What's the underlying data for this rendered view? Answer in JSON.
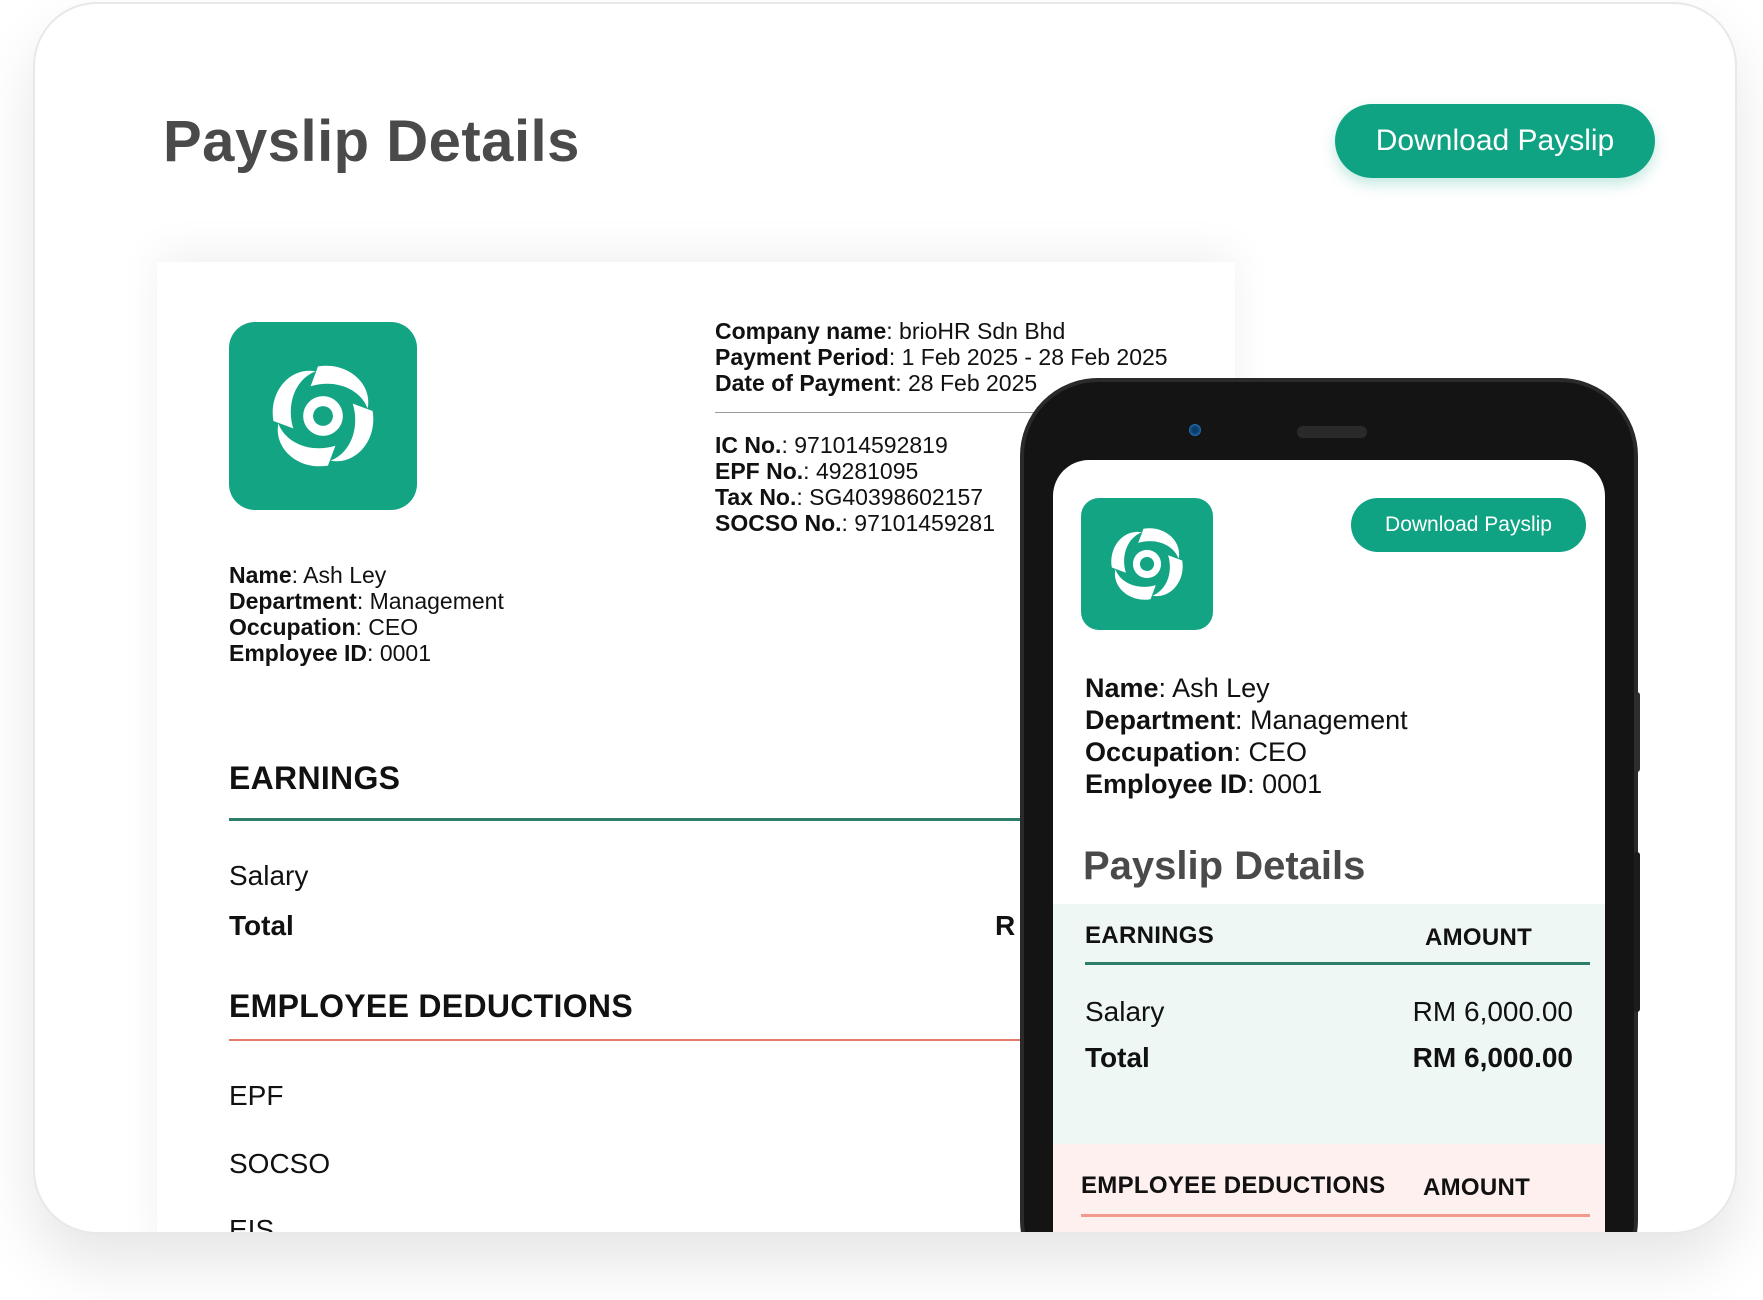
{
  "header": {
    "title": "Payslip Details",
    "download_label": "Download Payslip"
  },
  "doc": {
    "company": [
      {
        "label": "Company name",
        "value": "brioHR Sdn Bhd"
      },
      {
        "label": "Payment Period",
        "value": "1 Feb 2025 - 28 Feb 2025"
      },
      {
        "label": "Date of Payment",
        "value": "28 Feb 2025"
      }
    ],
    "ids": [
      {
        "label": "IC No.",
        "value": "971014592819"
      },
      {
        "label": "EPF No.",
        "value": "49281095"
      },
      {
        "label": "Tax No.",
        "value": "SG40398602157"
      },
      {
        "label": "SOCSO No.",
        "value": "97101459281"
      }
    ],
    "employee": [
      {
        "label": "Name",
        "value": "Ash Ley"
      },
      {
        "label": "Department",
        "value": "Management"
      },
      {
        "label": "Occupation",
        "value": "CEO"
      },
      {
        "label": "Employee ID",
        "value": "0001"
      }
    ],
    "earnings_heading": "EARNINGS",
    "salary_label": "Salary",
    "total_label": "Total",
    "total_cut": "R",
    "deductions_heading": "EMPLOYEE DEDUCTIONS",
    "deductions": [
      "EPF",
      "SOCSO",
      "EIS"
    ]
  },
  "mobile": {
    "download_label": "Download Payslip",
    "employee": [
      {
        "label": "Name",
        "value": "Ash Ley"
      },
      {
        "label": "Department",
        "value": "Management"
      },
      {
        "label": "Occupation",
        "value": "CEO"
      },
      {
        "label": "Employee ID",
        "value": "0001"
      }
    ],
    "title": "Payslip Details",
    "earnings_heading": "EARNINGS",
    "amount_heading": "AMOUNT",
    "salary_label": "Salary",
    "salary_amount": "RM 6,000.00",
    "total_label": "Total",
    "total_amount": "RM 6,000.00",
    "deductions_heading": "EMPLOYEE DEDUCTIONS",
    "deductions_amount_heading": "AMOUNT"
  },
  "colors": {
    "brand": "#10a383",
    "earnings_line": "#2e7d6b",
    "deductions_line": "#e47a6c"
  },
  "icons": {
    "logo": "swirl-logo-icon"
  }
}
